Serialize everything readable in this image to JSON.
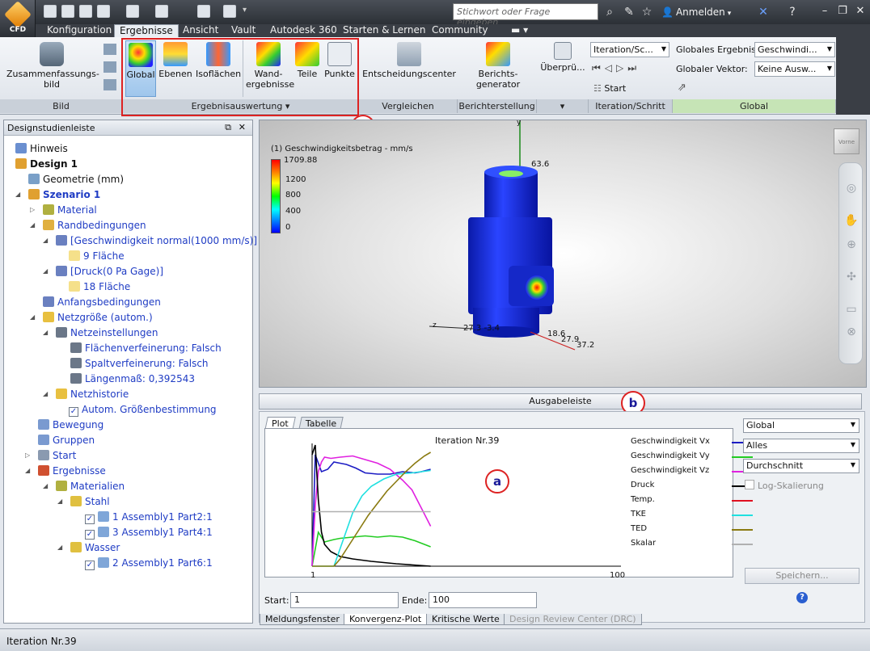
{
  "app": {
    "badge": "CFD"
  },
  "search": {
    "placeholder": "Stichwort oder Frage eingeben"
  },
  "user": {
    "login": "Anmelden"
  },
  "tabs": [
    "Konfiguration",
    "Ergebnisse",
    "Ansicht",
    "Vault",
    "Autodesk 360",
    "Starten & Lernen",
    "Community"
  ],
  "ribbon": {
    "bild": {
      "summary": "Zusammenfassungs-bild",
      "label": "Bild"
    },
    "auswertung": {
      "buttons": [
        "Global",
        "Ebenen",
        "Isoflächen",
        "Wand-ergebnisse",
        "Teile",
        "Punkte"
      ],
      "label": "Ergebnisauswertung"
    },
    "vergleichen": {
      "button": "Entscheidungscenter",
      "label": "Vergleichen"
    },
    "bericht": {
      "button": "Berichts-generator",
      "label": "Berichterstellung"
    },
    "ueberpruefen": {
      "button": "Überprü..."
    },
    "iteration": {
      "combo": "Iteration/Sc...",
      "start": "Start",
      "label": "Iteration/Schritt"
    },
    "global": {
      "ergebnis_label": "Globales Ergebnis:",
      "ergebnis_value": "Geschwindi...",
      "vektor_label": "Globaler Vektor:",
      "vektor_value": "Keine Ausw...",
      "label": "Global"
    }
  },
  "callouts": {
    "a": "a",
    "b": "b",
    "c": "c"
  },
  "panel": {
    "title": "Designstudienleiste",
    "tree": [
      {
        "text": "Hinweis"
      },
      {
        "text": "Design 1"
      },
      {
        "text": "Geometrie (mm)"
      },
      {
        "text": "Szenario 1"
      },
      {
        "text": "Material"
      },
      {
        "text": "Randbedingungen"
      },
      {
        "text": "[Geschwindigkeit normal(1000 mm/s)]"
      },
      {
        "text": "9 Fläche"
      },
      {
        "text": "[Druck(0 Pa Gage)]"
      },
      {
        "text": "18 Fläche"
      },
      {
        "text": "Anfangsbedingungen"
      },
      {
        "text": "Netzgröße (autom.)"
      },
      {
        "text": "Netzeinstellungen"
      },
      {
        "text": "Flächenverfeinerung: Falsch"
      },
      {
        "text": "Spaltverfeinerung: Falsch"
      },
      {
        "text": "Längenmaß: 0,392543"
      },
      {
        "text": "Netzhistorie"
      },
      {
        "text": "Autom. Größenbestimmung"
      },
      {
        "text": "Bewegung"
      },
      {
        "text": "Gruppen"
      },
      {
        "text": "Start"
      },
      {
        "text": "Ergebnisse"
      },
      {
        "text": "Materialien"
      },
      {
        "text": "Stahl"
      },
      {
        "text": "1 Assembly1  Part2:1"
      },
      {
        "text": "3 Assembly1  Part4:1"
      },
      {
        "text": "Wasser"
      },
      {
        "text": "2 Assembly1  Part6:1"
      }
    ]
  },
  "viewport": {
    "legend_title": "(1) Geschwindigkeitsbetrag - mm/s",
    "legend_max": "1709.88",
    "legend_ticks": [
      "1200",
      "800",
      "400",
      "0"
    ],
    "probes": {
      "top": "63.6",
      "axis_y": "y",
      "axis_z": "z",
      "left": "27.3 -3.4",
      "r1": "18.6",
      "r2": "27.9",
      "r3": "37.2"
    },
    "viewcube": "Vorne"
  },
  "output": {
    "bar_label": "Ausgabeleiste",
    "tabs": [
      "Plot",
      "Tabelle"
    ],
    "iteration": "Iteration Nr.39",
    "x_min": "1",
    "x_max": "100",
    "start_label": "Start:",
    "start_value": "1",
    "end_label": "Ende:",
    "end_value": "100",
    "combo_scope": "Global",
    "combo_filter": "Alles",
    "combo_mode": "Durchschnitt",
    "log_label": "Log-Skalierung",
    "save": "Speichern...",
    "bottom_tabs": [
      "Meldungsfenster",
      "Konvergenz-Plot",
      "Kritische Werte",
      "Design Review Center (DRC)"
    ]
  },
  "chart_data": {
    "type": "line",
    "x_range": [
      1,
      100
    ],
    "title": "Iteration Nr.39",
    "series": [
      {
        "name": "Geschwindigkeit Vx",
        "color": "#1c1cc4"
      },
      {
        "name": "Geschwindigkeit Vy",
        "color": "#22cc22"
      },
      {
        "name": "Geschwindigkeit Vz",
        "color": "#e020e0"
      },
      {
        "name": "Druck",
        "color": "#000000"
      },
      {
        "name": "Temp.",
        "color": "#e01020"
      },
      {
        "name": "TKE",
        "color": "#20e0e0"
      },
      {
        "name": "TED",
        "color": "#8a7a10"
      },
      {
        "name": "Skalar",
        "color": "#b0b0b0"
      }
    ],
    "curves": {
      "Geschwindigkeit Vx": [
        [
          1,
          0.0
        ],
        [
          2,
          0.92
        ],
        [
          4,
          0.78
        ],
        [
          6,
          0.8
        ],
        [
          8,
          0.86
        ],
        [
          10,
          0.85
        ],
        [
          12,
          0.84
        ],
        [
          15,
          0.81
        ],
        [
          18,
          0.77
        ],
        [
          22,
          0.76
        ],
        [
          26,
          0.76
        ],
        [
          30,
          0.78
        ],
        [
          34,
          0.77
        ],
        [
          36,
          0.78
        ],
        [
          39,
          0.8
        ]
      ],
      "Geschwindigkeit Vy": [
        [
          1,
          0.0
        ],
        [
          3,
          0.28
        ],
        [
          5,
          0.2
        ],
        [
          8,
          0.22
        ],
        [
          10,
          0.23
        ],
        [
          14,
          0.24
        ],
        [
          18,
          0.25
        ],
        [
          22,
          0.24
        ],
        [
          26,
          0.25
        ],
        [
          30,
          0.24
        ],
        [
          34,
          0.21
        ],
        [
          37,
          0.18
        ],
        [
          39,
          0.16
        ]
      ],
      "Geschwindigkeit Vz": [
        [
          1,
          0.0
        ],
        [
          2,
          0.5
        ],
        [
          3,
          0.78
        ],
        [
          4,
          0.86
        ],
        [
          5,
          0.9
        ],
        [
          7,
          0.89
        ],
        [
          10,
          0.9
        ],
        [
          14,
          0.91
        ],
        [
          18,
          0.88
        ],
        [
          22,
          0.85
        ],
        [
          26,
          0.8
        ],
        [
          30,
          0.71
        ],
        [
          33,
          0.63
        ],
        [
          36,
          0.48
        ],
        [
          39,
          0.33
        ]
      ],
      "Druck": [
        [
          1,
          0.92
        ],
        [
          2,
          1.0
        ],
        [
          3,
          0.55
        ],
        [
          4,
          0.28
        ],
        [
          5,
          0.18
        ],
        [
          7,
          0.12
        ],
        [
          10,
          0.08
        ],
        [
          14,
          0.06
        ],
        [
          20,
          0.04
        ],
        [
          28,
          0.02
        ],
        [
          39,
          0.0
        ]
      ],
      "Temp.": [],
      "TKE": [
        [
          1,
          0.0
        ],
        [
          5,
          0.0
        ],
        [
          8,
          0.0
        ],
        [
          11,
          0.22
        ],
        [
          14,
          0.44
        ],
        [
          17,
          0.58
        ],
        [
          20,
          0.66
        ],
        [
          24,
          0.72
        ],
        [
          28,
          0.76
        ],
        [
          33,
          0.77
        ],
        [
          39,
          0.79
        ]
      ],
      "TED": [
        [
          1,
          0.0
        ],
        [
          8,
          0.0
        ],
        [
          10,
          0.06
        ],
        [
          13,
          0.18
        ],
        [
          16,
          0.3
        ],
        [
          19,
          0.42
        ],
        [
          22,
          0.52
        ],
        [
          25,
          0.62
        ],
        [
          28,
          0.7
        ],
        [
          31,
          0.78
        ],
        [
          34,
          0.85
        ],
        [
          37,
          0.91
        ],
        [
          39,
          0.94
        ]
      ],
      "Skalar": [
        [
          1,
          0.45
        ],
        [
          39,
          0.45
        ]
      ]
    }
  }
}
